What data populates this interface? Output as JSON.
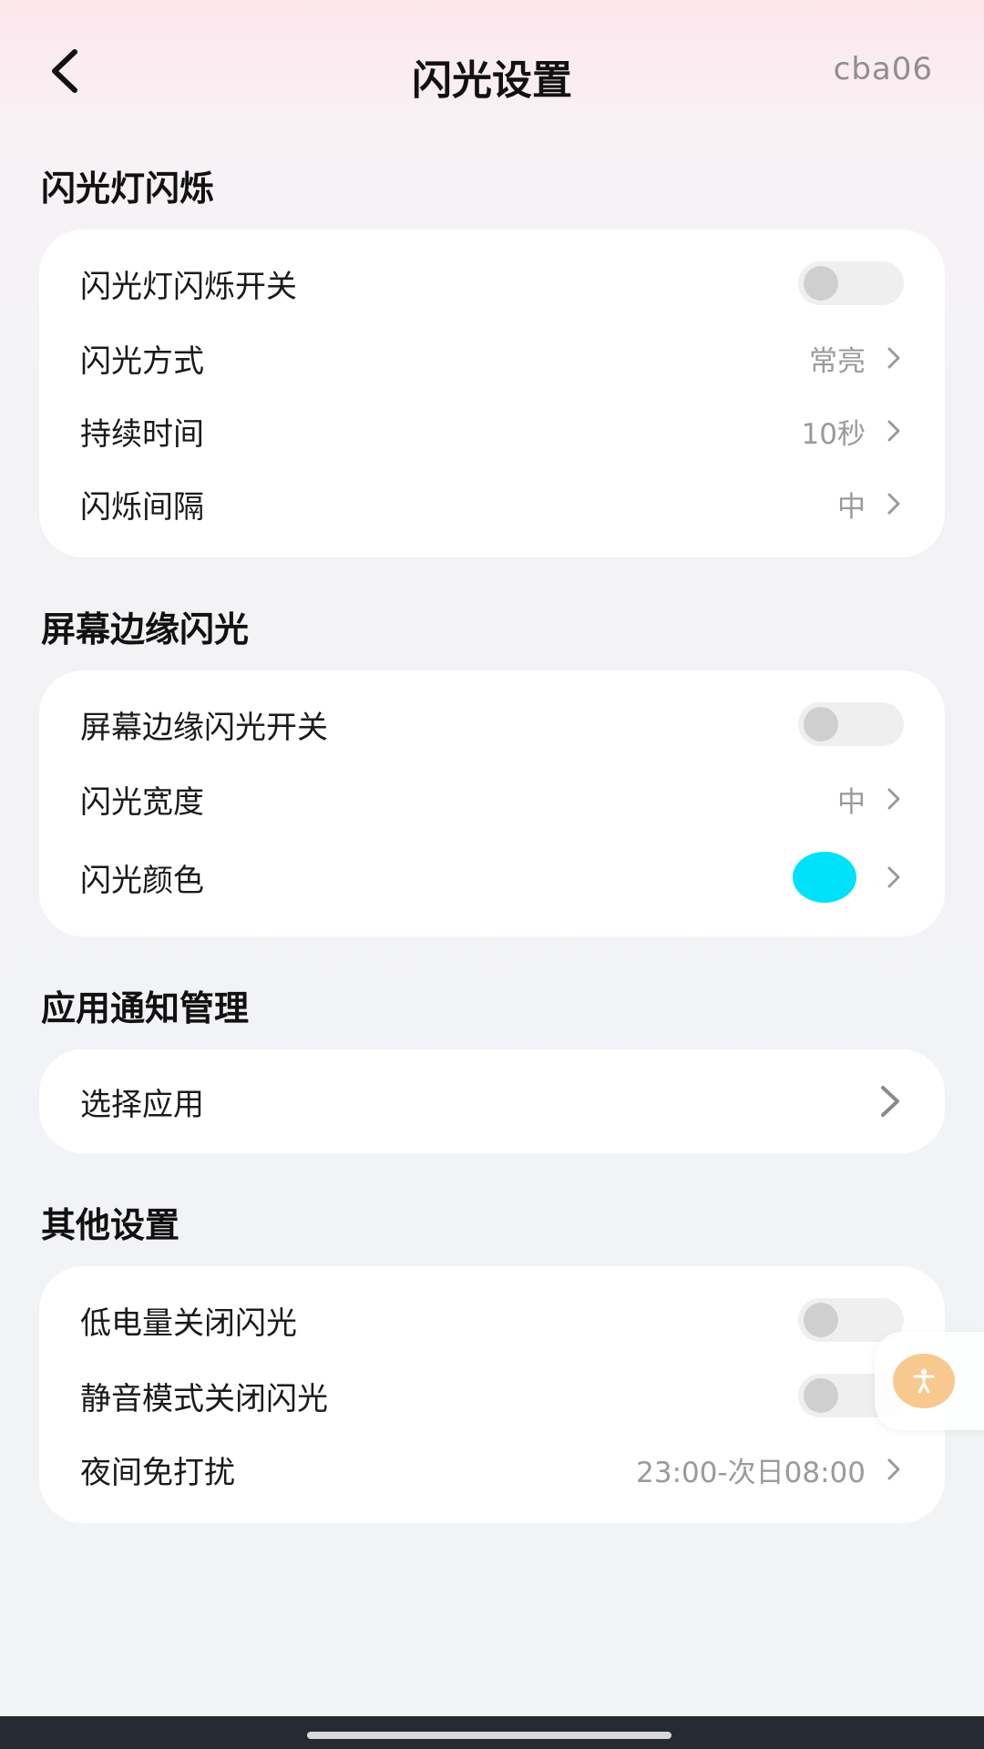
{
  "header": {
    "title": "闪光设置",
    "account": "cba06",
    "back_icon": "chevron-left-icon"
  },
  "sections": {
    "flashlight": {
      "title": "闪光灯闪烁",
      "rows": {
        "switch": {
          "label": "闪光灯闪烁开关",
          "enabled": false
        },
        "mode": {
          "label": "闪光方式",
          "value": "常亮"
        },
        "duration": {
          "label": "持续时间",
          "value": "10秒"
        },
        "interval": {
          "label": "闪烁间隔",
          "value": "中"
        }
      }
    },
    "edge": {
      "title": "屏幕边缘闪光",
      "rows": {
        "switch": {
          "label": "屏幕边缘闪光开关",
          "enabled": false
        },
        "width": {
          "label": "闪光宽度",
          "value": "中"
        },
        "color": {
          "label": "闪光颜色",
          "value_color": "#00e1fb"
        }
      }
    },
    "apps": {
      "title": "应用通知管理",
      "rows": {
        "select": {
          "label": "选择应用"
        }
      }
    },
    "other": {
      "title": "其他设置",
      "rows": {
        "low_battery": {
          "label": "低电量关闭闪光",
          "enabled": false
        },
        "silent": {
          "label": "静音模式关闭闪光",
          "enabled": false
        },
        "night": {
          "label": "夜间免打扰",
          "value": "23:00-次日08:00"
        }
      }
    }
  },
  "floating": {
    "icon": "accessibility-icon",
    "color": "#f7c98f"
  },
  "colors": {
    "toggle_off_track": "#efefef",
    "toggle_off_knob": "#cfcfcf",
    "nav_bar": "#262a33"
  }
}
